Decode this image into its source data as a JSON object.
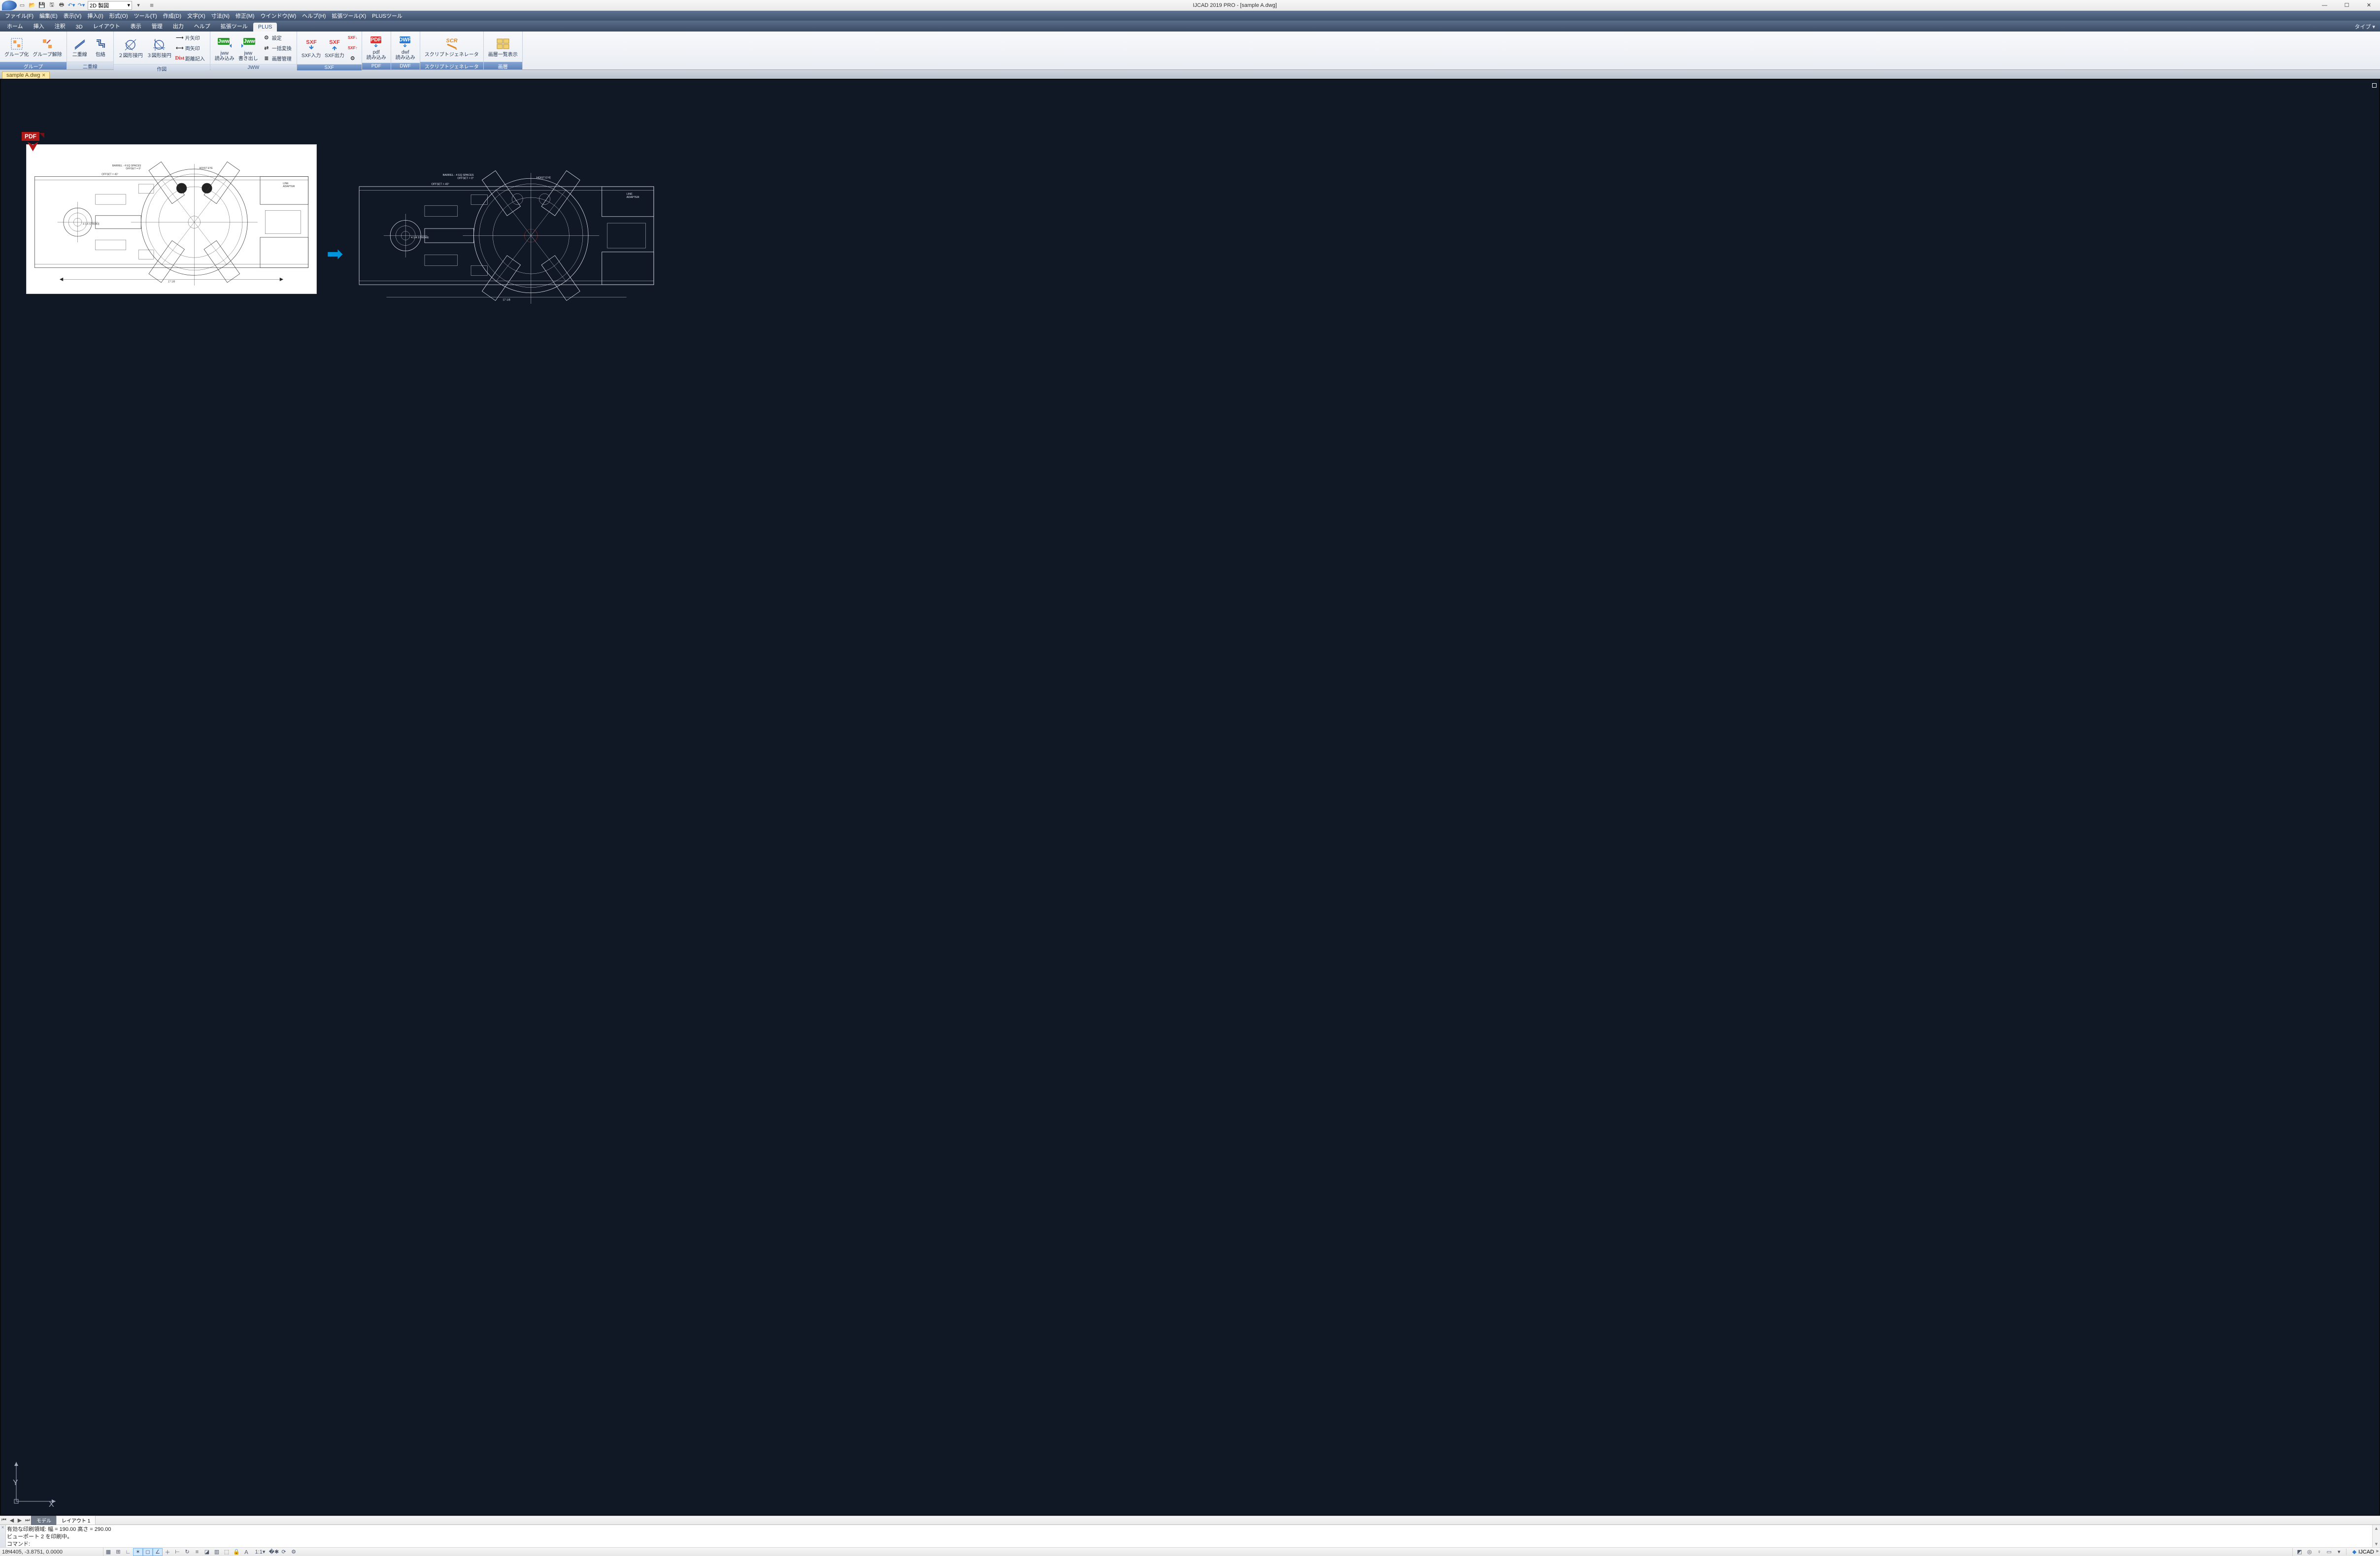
{
  "title": "IJCAD 2019 PRO - [sample A.dwg]",
  "qat": {
    "workspace": "2D 製図"
  },
  "menus": [
    "ファイル(F)",
    "編集(E)",
    "表示(V)",
    "挿入(I)",
    "形式(O)",
    "ツール(T)",
    "作成(D)",
    "文字(X)",
    "寸法(N)",
    "修正(M)",
    "ウインドウ(W)",
    "ヘルプ(H)",
    "拡張ツール(X)",
    "PLUSツール"
  ],
  "tabs": {
    "items": [
      "ホーム",
      "挿入",
      "注釈",
      "3D",
      "レイアウト",
      "表示",
      "管理",
      "出力",
      "ヘルプ",
      "拡張ツール",
      "PLUS"
    ],
    "active": 10,
    "right": "タイプ ▾"
  },
  "ribbon": {
    "group": {
      "title": "グループ",
      "make": "グループ化",
      "break": "グループ解除"
    },
    "dbl": {
      "title": "二重線",
      "line": "二重線",
      "enclose": "包絡"
    },
    "draw": {
      "title": "作図",
      "c2": "２図形接円",
      "c3": "３図形接円",
      "a1": "片矢印",
      "a2": "両矢印",
      "dist": "距離記入"
    },
    "jww": {
      "title": "JWW",
      "in": "jww\n読み込み",
      "out": "jww\n書き出し",
      "set": "設定",
      "batch": "一括変換",
      "lay": "画層管理"
    },
    "sxf": {
      "title": "SXF",
      "in": "SXF入力",
      "out": "SXF出力",
      "sin": "SXF入力",
      "sout": "SXF出力"
    },
    "pdf": {
      "title": "PDF",
      "in": "pdf\n読み込み"
    },
    "dwf": {
      "title": "DWF",
      "in": "dwf\n読み込み"
    },
    "scr": {
      "title": "スクリプトジェネレータ",
      "gen": "スクリプトジェネレータ"
    },
    "lay": {
      "title": "画層",
      "list": "画層一覧表示"
    }
  },
  "filetabs": {
    "items": [
      {
        "label": "sample A.dwg"
      }
    ]
  },
  "layout": {
    "tabs": [
      "モデル",
      "レイアウト 1"
    ],
    "active": 0
  },
  "pdf": {
    "badge": "PDF"
  },
  "drawing": {
    "notes": {
      "barrel": "BARREL - 4 EQ SPACES",
      "offset": "OFFSET = 0°",
      "offset2": "OFFSET = 45°",
      "hoist": "HOIST EYE",
      "line": "LINE",
      "adapter": "ADAPTER",
      "stroke": "4 1/4 STROKE",
      "dim": "17 1/8"
    }
  },
  "canvas": {
    "ucs": {
      "x": "X",
      "y": "Y"
    }
  },
  "cmd": {
    "l1": "有効な印刷領域:    幅 = 190.00  高さ = 290.00",
    "l2": "ビューポート 2 を印刷中。",
    "prompt": "コマンド:"
  },
  "status": {
    "coords": "18.4405, -3.8751, 0.0000",
    "scale": "1:1",
    "vendor": "IJCAD"
  }
}
